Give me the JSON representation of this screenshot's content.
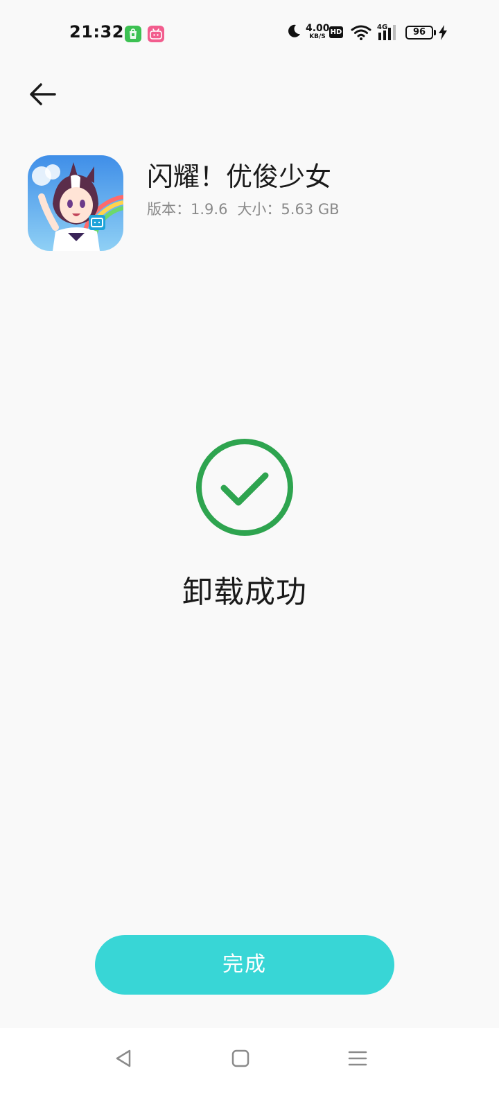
{
  "status_bar": {
    "time": "21:32",
    "speed_value": "4.00",
    "speed_unit": "KB/S",
    "hd_label": "HD",
    "network_type": "4G",
    "battery_level": "96",
    "icons": [
      "app-store-notification-icon",
      "bilibili-notification-icon",
      "moon-icon",
      "wifi-icon",
      "cellular-signal-icon",
      "battery-icon",
      "charging-icon"
    ]
  },
  "header": {
    "back_icon": "back-arrow-icon"
  },
  "app": {
    "name": "闪耀！优俊少女",
    "version": "版本：1.9.6",
    "size": "大小：5.63 GB",
    "icon": "app-icon"
  },
  "result": {
    "status_icon": "check-circle-icon",
    "message": "卸载成功"
  },
  "actions": {
    "done_label": "完成"
  },
  "navigation": {
    "items": [
      "back-triangle-icon",
      "home-square-icon",
      "menu-lines-icon"
    ]
  },
  "colors": {
    "background": "#f9f9f9",
    "success_green": "#2ea44f",
    "button_teal": "#38d6d6",
    "text_primary": "#1a1a1a",
    "text_secondary": "#8a8a8a"
  }
}
